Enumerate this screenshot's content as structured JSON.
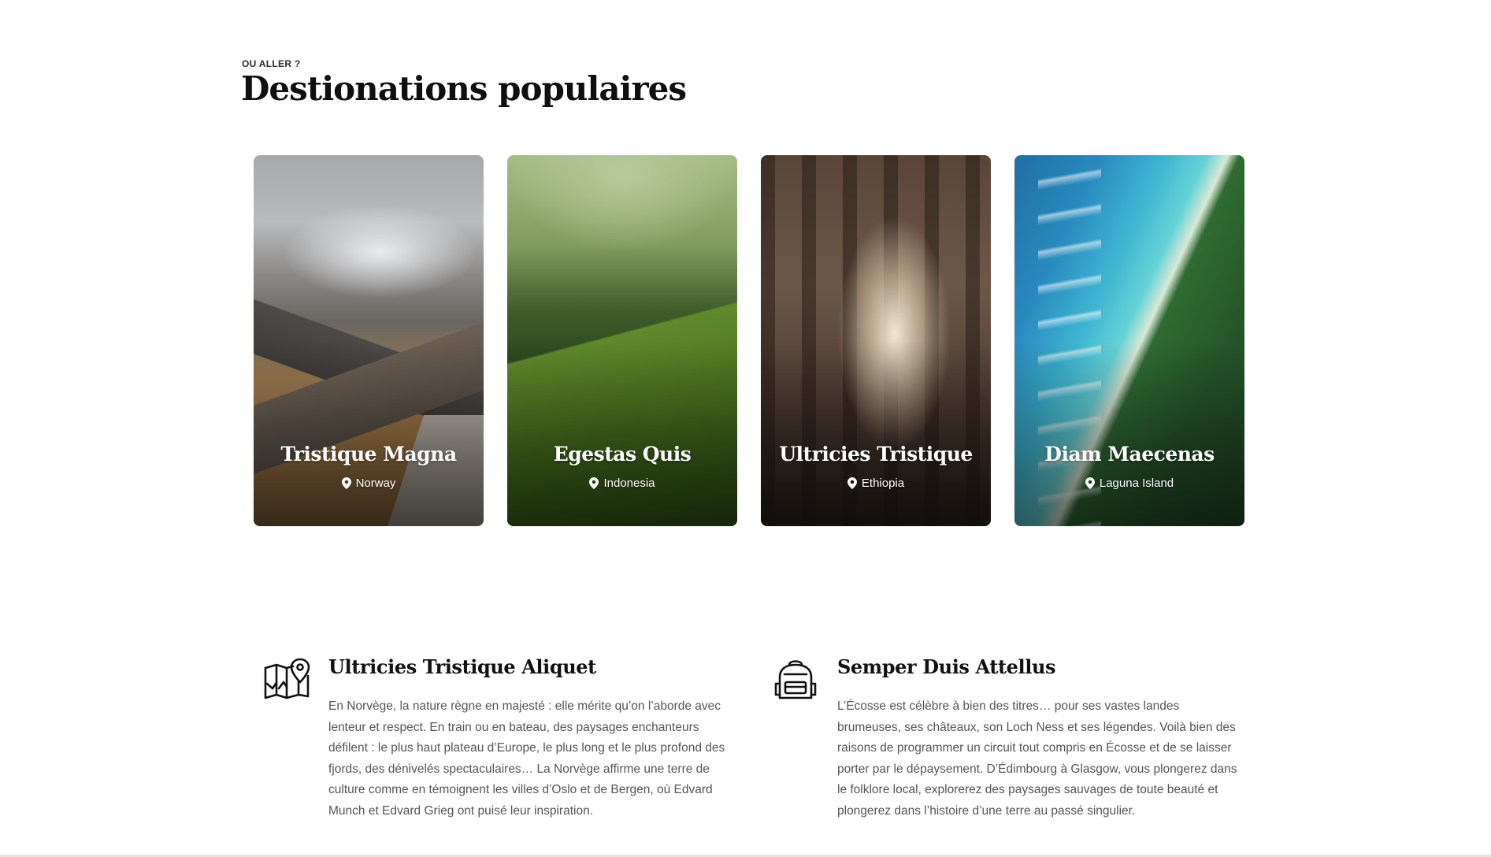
{
  "section": {
    "eyebrow": "OU ALLER ?",
    "title": "Destionations populaires"
  },
  "destinations": [
    {
      "name": "Tristique Magna",
      "location": "Norway"
    },
    {
      "name": "Egestas Quis",
      "location": "Indonesia"
    },
    {
      "name": "Ultricies Tristique",
      "location": "Ethiopia"
    },
    {
      "name": "Diam Maecenas",
      "location": "Laguna Island"
    }
  ],
  "features": [
    {
      "icon": "map-pin-icon",
      "title": "Ultricies Tristique Aliquet",
      "text": "En Norvège, la nature règne en majesté : elle mérite qu’on l’aborde avec lenteur et respect. En train ou en bateau, des paysages enchanteurs défilent : le plus haut plateau d’Europe, le plus long et le plus profond des fjords, des dénivelés spectaculaires… La Norvège affirme une terre de culture comme en témoignent les villes d’Oslo et de Bergen, où Edvard Munch et Edvard Grieg ont puisé leur inspiration."
    },
    {
      "icon": "backpack-icon",
      "title": "Semper Duis Attellus",
      "text": "L’Écosse est célèbre à bien des titres… pour ses vastes landes brumeuses, ses châteaux, son Loch Ness et ses légendes. Voilà bien des raisons de programmer un circuit tout compris en Écosse et de se laisser porter par le dépaysement. D’Édimbourg à Glasgow, vous plongerez dans le folklore local, explorerez des paysages sauvages de toute beauté et plongerez dans l’histoire d’une terre au passé singulier."
    }
  ],
  "colors": {
    "heading": "#0f0f0f",
    "body_text": "#555555",
    "card_text": "#ffffff"
  }
}
